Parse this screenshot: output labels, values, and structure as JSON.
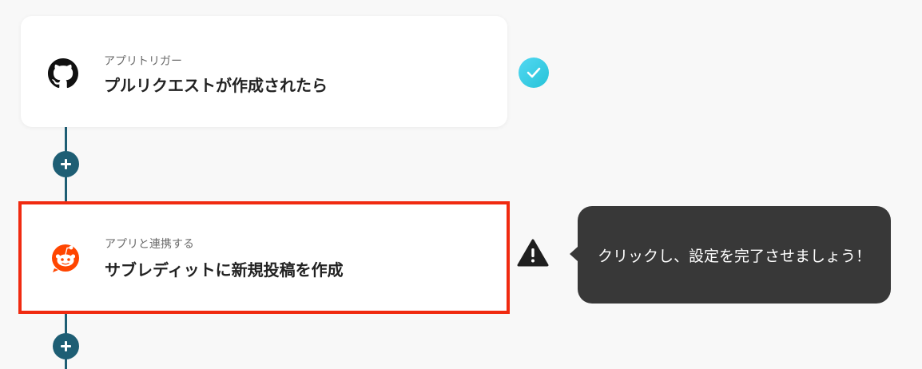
{
  "flow": {
    "trigger": {
      "subtitle": "アプリトリガー",
      "title": "プルリクエストが作成されたら",
      "icon": "github-icon",
      "status": "completed"
    },
    "action": {
      "subtitle": "アプリと連携する",
      "title": "サブレディットに新規投稿を作成",
      "icon": "reddit-icon",
      "status": "warning"
    }
  },
  "tooltip": {
    "message": "クリックし、設定を完了させましょう！"
  },
  "colors": {
    "connector": "#1e5e74",
    "highlight_border": "#f02a10",
    "check": "#27c3d8",
    "tooltip_bg": "#383838",
    "reddit": "#ff4500"
  }
}
